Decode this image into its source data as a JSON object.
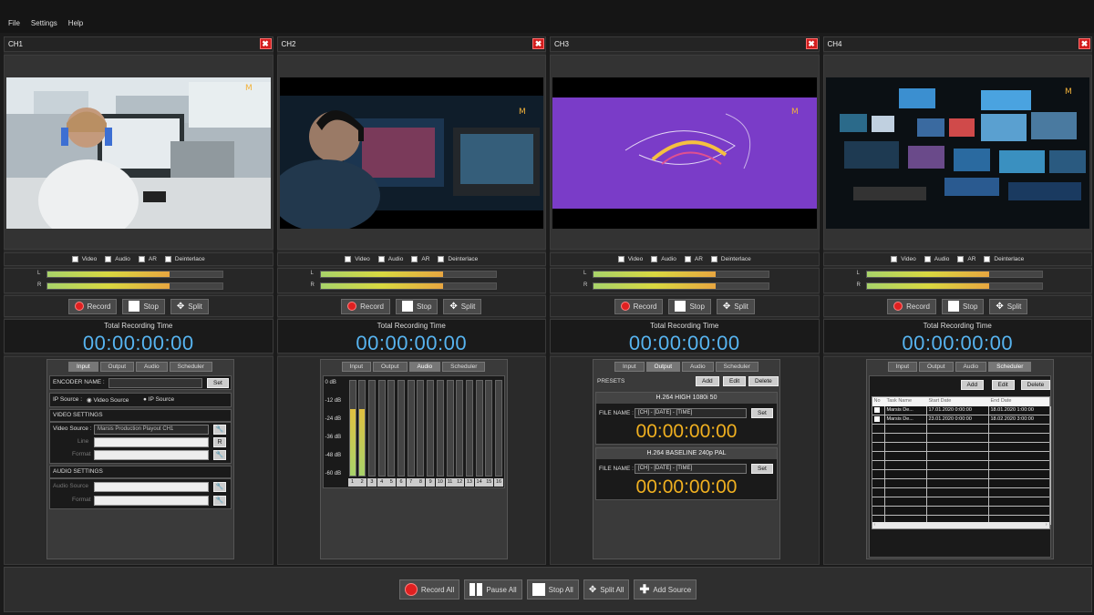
{
  "menu": {
    "file": "File",
    "settings": "Settings",
    "help": "Help"
  },
  "channels": [
    {
      "title": "CH1",
      "close": "✖"
    },
    {
      "title": "CH2",
      "close": "✖"
    },
    {
      "title": "CH3",
      "close": "✖"
    },
    {
      "title": "CH4",
      "close": "✖"
    }
  ],
  "options": {
    "video": "Video",
    "audio": "Audio",
    "ar": "AR",
    "deinterlace": "Deinterlace"
  },
  "levels": {
    "left_label": "L",
    "right_label": "R",
    "left_fill": 0.7,
    "right_fill": 0.7
  },
  "controls": {
    "record": "Record",
    "stop": "Stop",
    "split": "Split"
  },
  "timer": {
    "label": "Total Recording Time",
    "value": "00:00:00:00"
  },
  "tabs": {
    "input": "Input",
    "output": "Output",
    "audio": "Audio",
    "scheduler": "Scheduler"
  },
  "ch1_input": {
    "encoder_name_label": "ENCODER NAME :",
    "set": "Set",
    "ip_source_label": "IP Source :",
    "video_source_radio": "Video Source",
    "ip_source_radio": "IP Source",
    "video_settings": "VIDEO SETTINGS",
    "video_source_label": "Video Source :",
    "video_source_value": "Marsis Production Playout CH1",
    "line_label": "Line",
    "format_label": "Format",
    "audio_settings": "AUDIO SETTINGS",
    "audio_source_label": "Audio Source",
    "audio_format_label": "Format",
    "r_btn": "R"
  },
  "ch2_audio": {
    "db_labels": [
      "0 dB",
      "-12 dB",
      "-24 dB",
      "-36 dB",
      "-48 dB",
      "-60 dB"
    ],
    "channels": [
      "1",
      "2",
      "3",
      "4",
      "5",
      "6",
      "7",
      "8",
      "9",
      "10",
      "11",
      "12",
      "13",
      "14",
      "15",
      "16"
    ],
    "levels": [
      0.7,
      0.7,
      0,
      0,
      0,
      0,
      0,
      0,
      0,
      0,
      0,
      0,
      0,
      0,
      0,
      0
    ]
  },
  "ch3_output": {
    "presets_label": "PRESETS",
    "add": "Add",
    "edit": "Edit",
    "delete": "Delete",
    "preset1_title": "H.264 HIGH 1080i 50",
    "preset2_title": "H.264 BASELINE 240p PAL",
    "file_name_label": "FILE NAME :",
    "file_name_value": "[CH] - [DATE] - [TIME]",
    "set": "Set",
    "time": "00:00:00:00"
  },
  "ch4_scheduler": {
    "add": "Add",
    "edit": "Edit",
    "delete": "Delete",
    "headers": [
      "No",
      "Task Name",
      "Start Date",
      "End Date"
    ],
    "rows": [
      {
        "name": "Marsis De...",
        "start": "17.01.2020 0:00:00",
        "end": "18.01.2020 1:00:00"
      },
      {
        "name": "Marsis De...",
        "start": "23.01.2020 0:00:00",
        "end": "18.02.2020 3:00:00"
      }
    ]
  },
  "bottom": {
    "record_all": "Record All",
    "pause_all": "Pause All",
    "stop_all": "Stop All",
    "split_all": "Split All",
    "add_source": "Add Source"
  },
  "colors": {
    "timer": "#57b4f0",
    "output_timer": "#f0b020",
    "record": "#e02020"
  }
}
